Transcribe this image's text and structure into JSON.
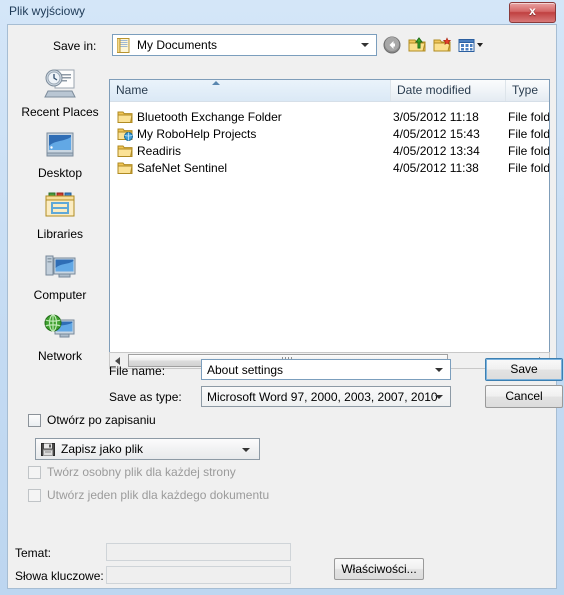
{
  "window": {
    "title": "Plik wyjściowy",
    "close_label": "x"
  },
  "savein": {
    "label": "Save in:",
    "value": "My Documents",
    "icon": "documents-folder-icon",
    "toolbar": [
      {
        "name": "back-button",
        "icon": "back-arrow-icon"
      },
      {
        "name": "up-one-level-button",
        "icon": "up-folder-icon"
      },
      {
        "name": "new-folder-button",
        "icon": "new-folder-icon"
      },
      {
        "name": "views-button",
        "icon": "views-icon"
      }
    ]
  },
  "places": [
    {
      "label": "Recent Places",
      "icon": "recent-places-icon"
    },
    {
      "label": "Desktop",
      "icon": "desktop-icon"
    },
    {
      "label": "Libraries",
      "icon": "libraries-icon"
    },
    {
      "label": "Computer",
      "icon": "computer-icon"
    },
    {
      "label": "Network",
      "icon": "network-icon"
    }
  ],
  "filelist": {
    "columns": [
      {
        "label": "Name",
        "sorted": "asc"
      },
      {
        "label": "Date modified",
        "sorted": null
      },
      {
        "label": "Type",
        "sorted": null
      }
    ],
    "rows": [
      {
        "name": "Bluetooth Exchange Folder",
        "date": "3/05/2012 11:18",
        "type": "File folder",
        "icon": "folder-icon"
      },
      {
        "name": "My RoboHelp Projects",
        "date": "4/05/2012 15:43",
        "type": "File folder",
        "icon": "web-folder-icon"
      },
      {
        "name": "Readiris",
        "date": "4/05/2012 13:34",
        "type": "File folder",
        "icon": "folder-icon"
      },
      {
        "name": "SafeNet Sentinel",
        "date": "4/05/2012 11:38",
        "type": "File folder",
        "icon": "folder-icon"
      }
    ]
  },
  "form": {
    "filename_label": "File name:",
    "filename_value": "About settings",
    "savetype_label": "Save as type:",
    "savetype_value": "Microsoft Word 97, 2000, 2003, 2007, 2010",
    "save_button": "Save",
    "cancel_button": "Cancel"
  },
  "options": {
    "open_after_save": {
      "label": "Otwórz po zapisaniu",
      "checked": false,
      "enabled": true
    },
    "save_mode": {
      "value": "Zapisz jako plik",
      "icon": "save-disk-icon"
    },
    "separate_file_per_page": {
      "label": "Twórz osobny plik dla każdej strony",
      "checked": false,
      "enabled": false
    },
    "one_file_per_document": {
      "label": "Utwórz jeden plik dla każdego dokumentu",
      "checked": false,
      "enabled": false
    }
  },
  "meta": {
    "subject_label": "Temat:",
    "subject_value": "",
    "keywords_label": "Słowa kluczowe:",
    "keywords_value": "",
    "properties_button": "Właściwości..."
  },
  "colors": {
    "accent": "#3c7fb1",
    "window_bg": "#c3daf2",
    "dialog_bg": "#f0f0f0",
    "close_red": "#c04040"
  }
}
